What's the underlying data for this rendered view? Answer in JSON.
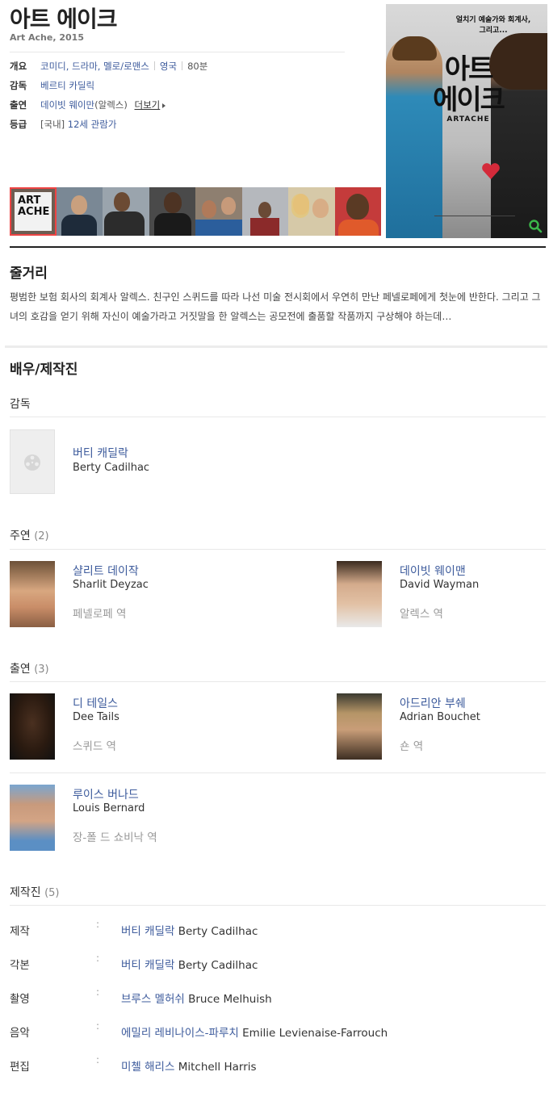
{
  "movie": {
    "title": "아트 에이크",
    "subtitle": "Art Ache, 2015"
  },
  "info": {
    "overview_label": "개요",
    "genres": "코미디, 드라마, 멜로/로맨스",
    "country": "영국",
    "runtime": "80분",
    "director_label": "감독",
    "director": "베르티 카딜릭",
    "cast_label": "출연",
    "cast": "데이빗 웨이만",
    "cast_role": "(알렉스)",
    "more_label": "더보기",
    "rating_label": "등급",
    "rating_region": "[국내]",
    "rating": "12세 관람가"
  },
  "poster": {
    "tagline_line1": "얼치기 예술가와 회계사,",
    "tagline_line2": "그리고...",
    "title_line1": "아트",
    "title_line2": "에이크",
    "sub_title": "ARTACHE",
    "zoom_icon": "search-icon"
  },
  "stills": [
    {
      "name": "still-1",
      "bg": "#6d5d52",
      "selected": true
    },
    {
      "name": "still-2",
      "bg": "#7a8895"
    },
    {
      "name": "still-3",
      "bg": "#9aa4ad"
    },
    {
      "name": "still-4",
      "bg": "#4a4a4a"
    },
    {
      "name": "still-5",
      "bg": "#8e7f70"
    },
    {
      "name": "still-6",
      "bg": "#b5b8bd"
    },
    {
      "name": "still-7",
      "bg": "#d6c9a8"
    },
    {
      "name": "still-8",
      "bg": "#c43b3b"
    }
  ],
  "synopsis": {
    "heading": "줄거리",
    "text": "평범한 보험 회사의 회계사 알렉스. 친구인 스퀴드를 따라 나선 미술 전시회에서 우연히 만난 페넬로페에게 첫눈에 반한다. 그리고 그녀의 호감을 얻기 위해 자신이 예술가라고 거짓말을 한 알렉스는 공모전에 출품할 작품까지 구상해야 하는데…"
  },
  "credits": {
    "heading": "배우/제작진",
    "director_section": "감독",
    "lead_section": "주연",
    "lead_count": "(2)",
    "support_section": "출연",
    "support_count": "(3)",
    "crew_section": "제작진",
    "crew_count": "(5)",
    "director": {
      "ko": "버티 캐딜락",
      "en": "Berty Cadilhac"
    },
    "leads": [
      {
        "ko": "샬리트 데이작",
        "en": "Sharlit Deyzac",
        "role": "페넬로페 역"
      },
      {
        "ko": "데이빗 웨이맨",
        "en": "David Wayman",
        "role": "알렉스 역"
      }
    ],
    "supports": [
      {
        "ko": "디 테일스",
        "en": "Dee Tails",
        "role": "스퀴드 역"
      },
      {
        "ko": "아드리안 부쉐",
        "en": "Adrian Bouchet",
        "role": "숀 역"
      },
      {
        "ko": "루이스 버나드",
        "en": "Louis Bernard",
        "role": "장-폴 드 쇼비낙 역"
      }
    ],
    "crew": [
      {
        "job": "제작",
        "ko": "버티 캐딜락",
        "en": "Berty Cadilhac"
      },
      {
        "job": "각본",
        "ko": "버티 캐딜락",
        "en": "Berty Cadilhac"
      },
      {
        "job": "촬영",
        "ko": "브루스 멜허쉬",
        "en": "Bruce Melhuish"
      },
      {
        "job": "음악",
        "ko": "에밀리 레비나이스-파루치",
        "en": "Emilie Levienaise-Farrouch"
      },
      {
        "job": "편집",
        "ko": "미첼 해리스",
        "en": "Mitchell Harris"
      }
    ],
    "colon": ":"
  }
}
